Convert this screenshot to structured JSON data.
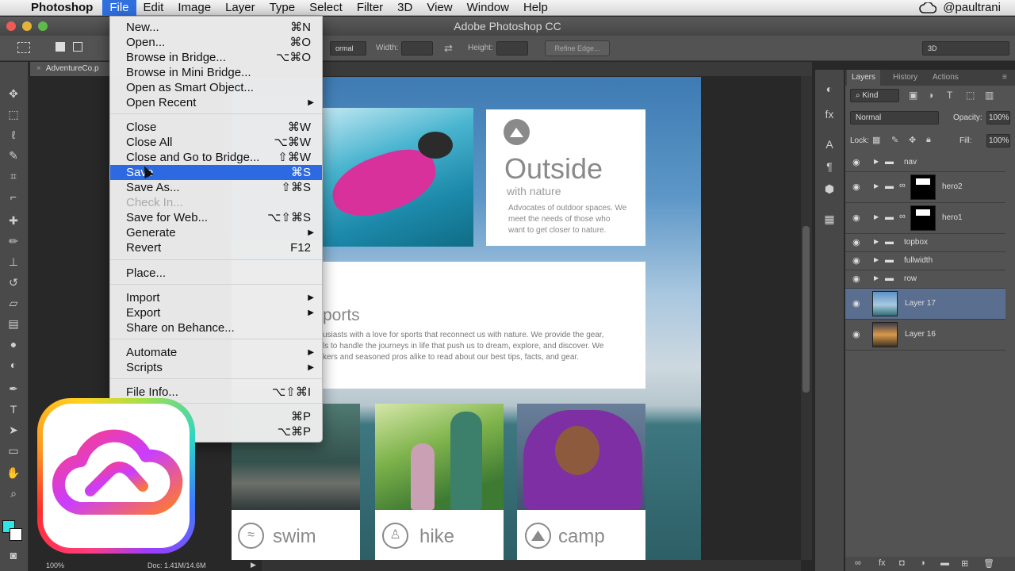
{
  "menubar": {
    "apple": "",
    "app_name": "Photoshop",
    "items": [
      "File",
      "Edit",
      "Image",
      "Layer",
      "Type",
      "Select",
      "Filter",
      "3D",
      "View",
      "Window",
      "Help"
    ],
    "user": "@paultrani"
  },
  "window": {
    "title": "Adobe Photoshop CC"
  },
  "options": {
    "mode": "ormal",
    "width_label": "Width:",
    "height_label": "Height:",
    "refine_edge": "Refine Edge...",
    "workspace": "3D"
  },
  "document": {
    "tab": "AdventureCo.p"
  },
  "file_menu": {
    "items": [
      {
        "label": "New...",
        "shortcut": "⌘N"
      },
      {
        "label": "Open...",
        "shortcut": "⌘O"
      },
      {
        "label": "Browse in Bridge...",
        "shortcut": "⌥⌘O"
      },
      {
        "label": "Browse in Mini Bridge...",
        "shortcut": ""
      },
      {
        "label": "Open as Smart Object...",
        "shortcut": ""
      },
      {
        "label": "Open Recent",
        "shortcut": "▶"
      },
      {
        "label": "Close",
        "shortcut": "⌘W"
      },
      {
        "label": "Close All",
        "shortcut": "⌥⌘W"
      },
      {
        "label": "Close and Go to Bridge...",
        "shortcut": "⇧⌘W"
      },
      {
        "label": "Save",
        "shortcut": "⌘S"
      },
      {
        "label": "Save As...",
        "shortcut": "⇧⌘S"
      },
      {
        "label": "Check In...",
        "shortcut": ""
      },
      {
        "label": "Save for Web...",
        "shortcut": "⌥⇧⌘S"
      },
      {
        "label": "Generate",
        "shortcut": "▶"
      },
      {
        "label": "Revert",
        "shortcut": "F12"
      },
      {
        "label": "Place...",
        "shortcut": ""
      },
      {
        "label": "Import",
        "shortcut": "▶"
      },
      {
        "label": "Export",
        "shortcut": "▶"
      },
      {
        "label": "Share on Behance...",
        "shortcut": ""
      },
      {
        "label": "Automate",
        "shortcut": "▶"
      },
      {
        "label": "Scripts",
        "shortcut": "▶"
      },
      {
        "label": "File Info...",
        "shortcut": "⌥⇧⌘I"
      },
      {
        "label": "",
        "shortcut": "⌘P"
      },
      {
        "label": "py",
        "shortcut": "⌥⌘P"
      }
    ]
  },
  "canvas": {
    "outside_title": "Outside",
    "outside_sub": "with nature",
    "outside_body_1": "Advocates of outdoor spaces. We",
    "outside_body_2": "meet the needs of those who",
    "outside_body_3": "want to get closer to nature.",
    "sports_heading": "ports",
    "sports_body_1": "usiasts with a love for sports that reconnect us with nature. We provide the gear,",
    "sports_body_2": "ls to handle the journeys in life that push us to dream, explore, and discover. We",
    "sports_body_3": "kers and seasoned pros alike to read about our best tips, facts, and gear.",
    "tiles": [
      "swim",
      "hike",
      "camp"
    ]
  },
  "status": {
    "zoom": "100%",
    "doc": "Doc: 1.41M/14.6M"
  },
  "layers_panel": {
    "tabs": [
      "Layers",
      "History",
      "Actions"
    ],
    "kind": "Kind",
    "blend": "Normal",
    "opacity_label": "Opacity:",
    "opacity": "100%",
    "lock_label": "Lock:",
    "fill_label": "Fill:",
    "fill": "100%",
    "layers": [
      "nav",
      "hero2",
      "hero1",
      "topbox",
      "fullwidth",
      "row",
      "Layer 17",
      "Layer 16"
    ]
  },
  "colors": {
    "menu_highlight": "#2d69e0",
    "selected_layer": "#5a6e8f"
  }
}
